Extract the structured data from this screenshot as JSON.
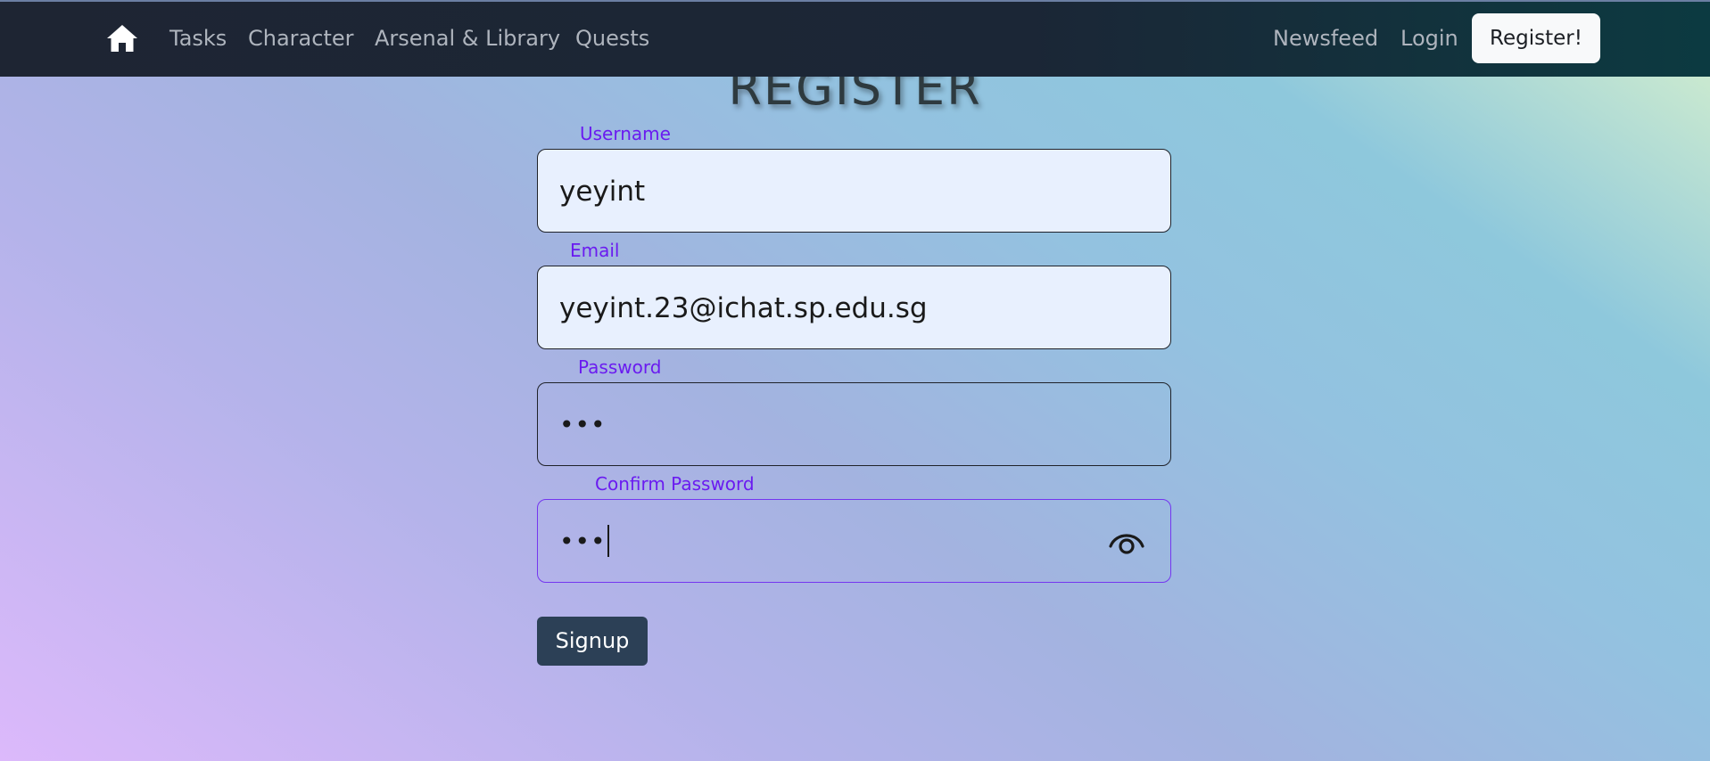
{
  "nav": {
    "home_icon": "home-icon",
    "links": [
      "Tasks",
      "Character",
      "Arsenal & Library",
      "Quests"
    ],
    "right_links": [
      "Newsfeed",
      "Login"
    ],
    "register_label": "Register!"
  },
  "page": {
    "title": "REGISTER"
  },
  "form": {
    "username": {
      "label": "Username",
      "value": "yeyint"
    },
    "email": {
      "label": "Email",
      "value": "yeyint.23@ichat.sp.edu.sg"
    },
    "password": {
      "label": "Password",
      "value": "•••"
    },
    "confirm_password": {
      "label": "Confirm Password",
      "value": "•••",
      "toggle_icon": "eye-icon"
    },
    "signup_label": "Signup"
  },
  "colors": {
    "label": "#6a1bf0",
    "nav_bg": "#1e2533",
    "button_bg": "#2c4056",
    "input_filled_bg": "#e8f0fe",
    "focus_border": "#7436f0"
  }
}
